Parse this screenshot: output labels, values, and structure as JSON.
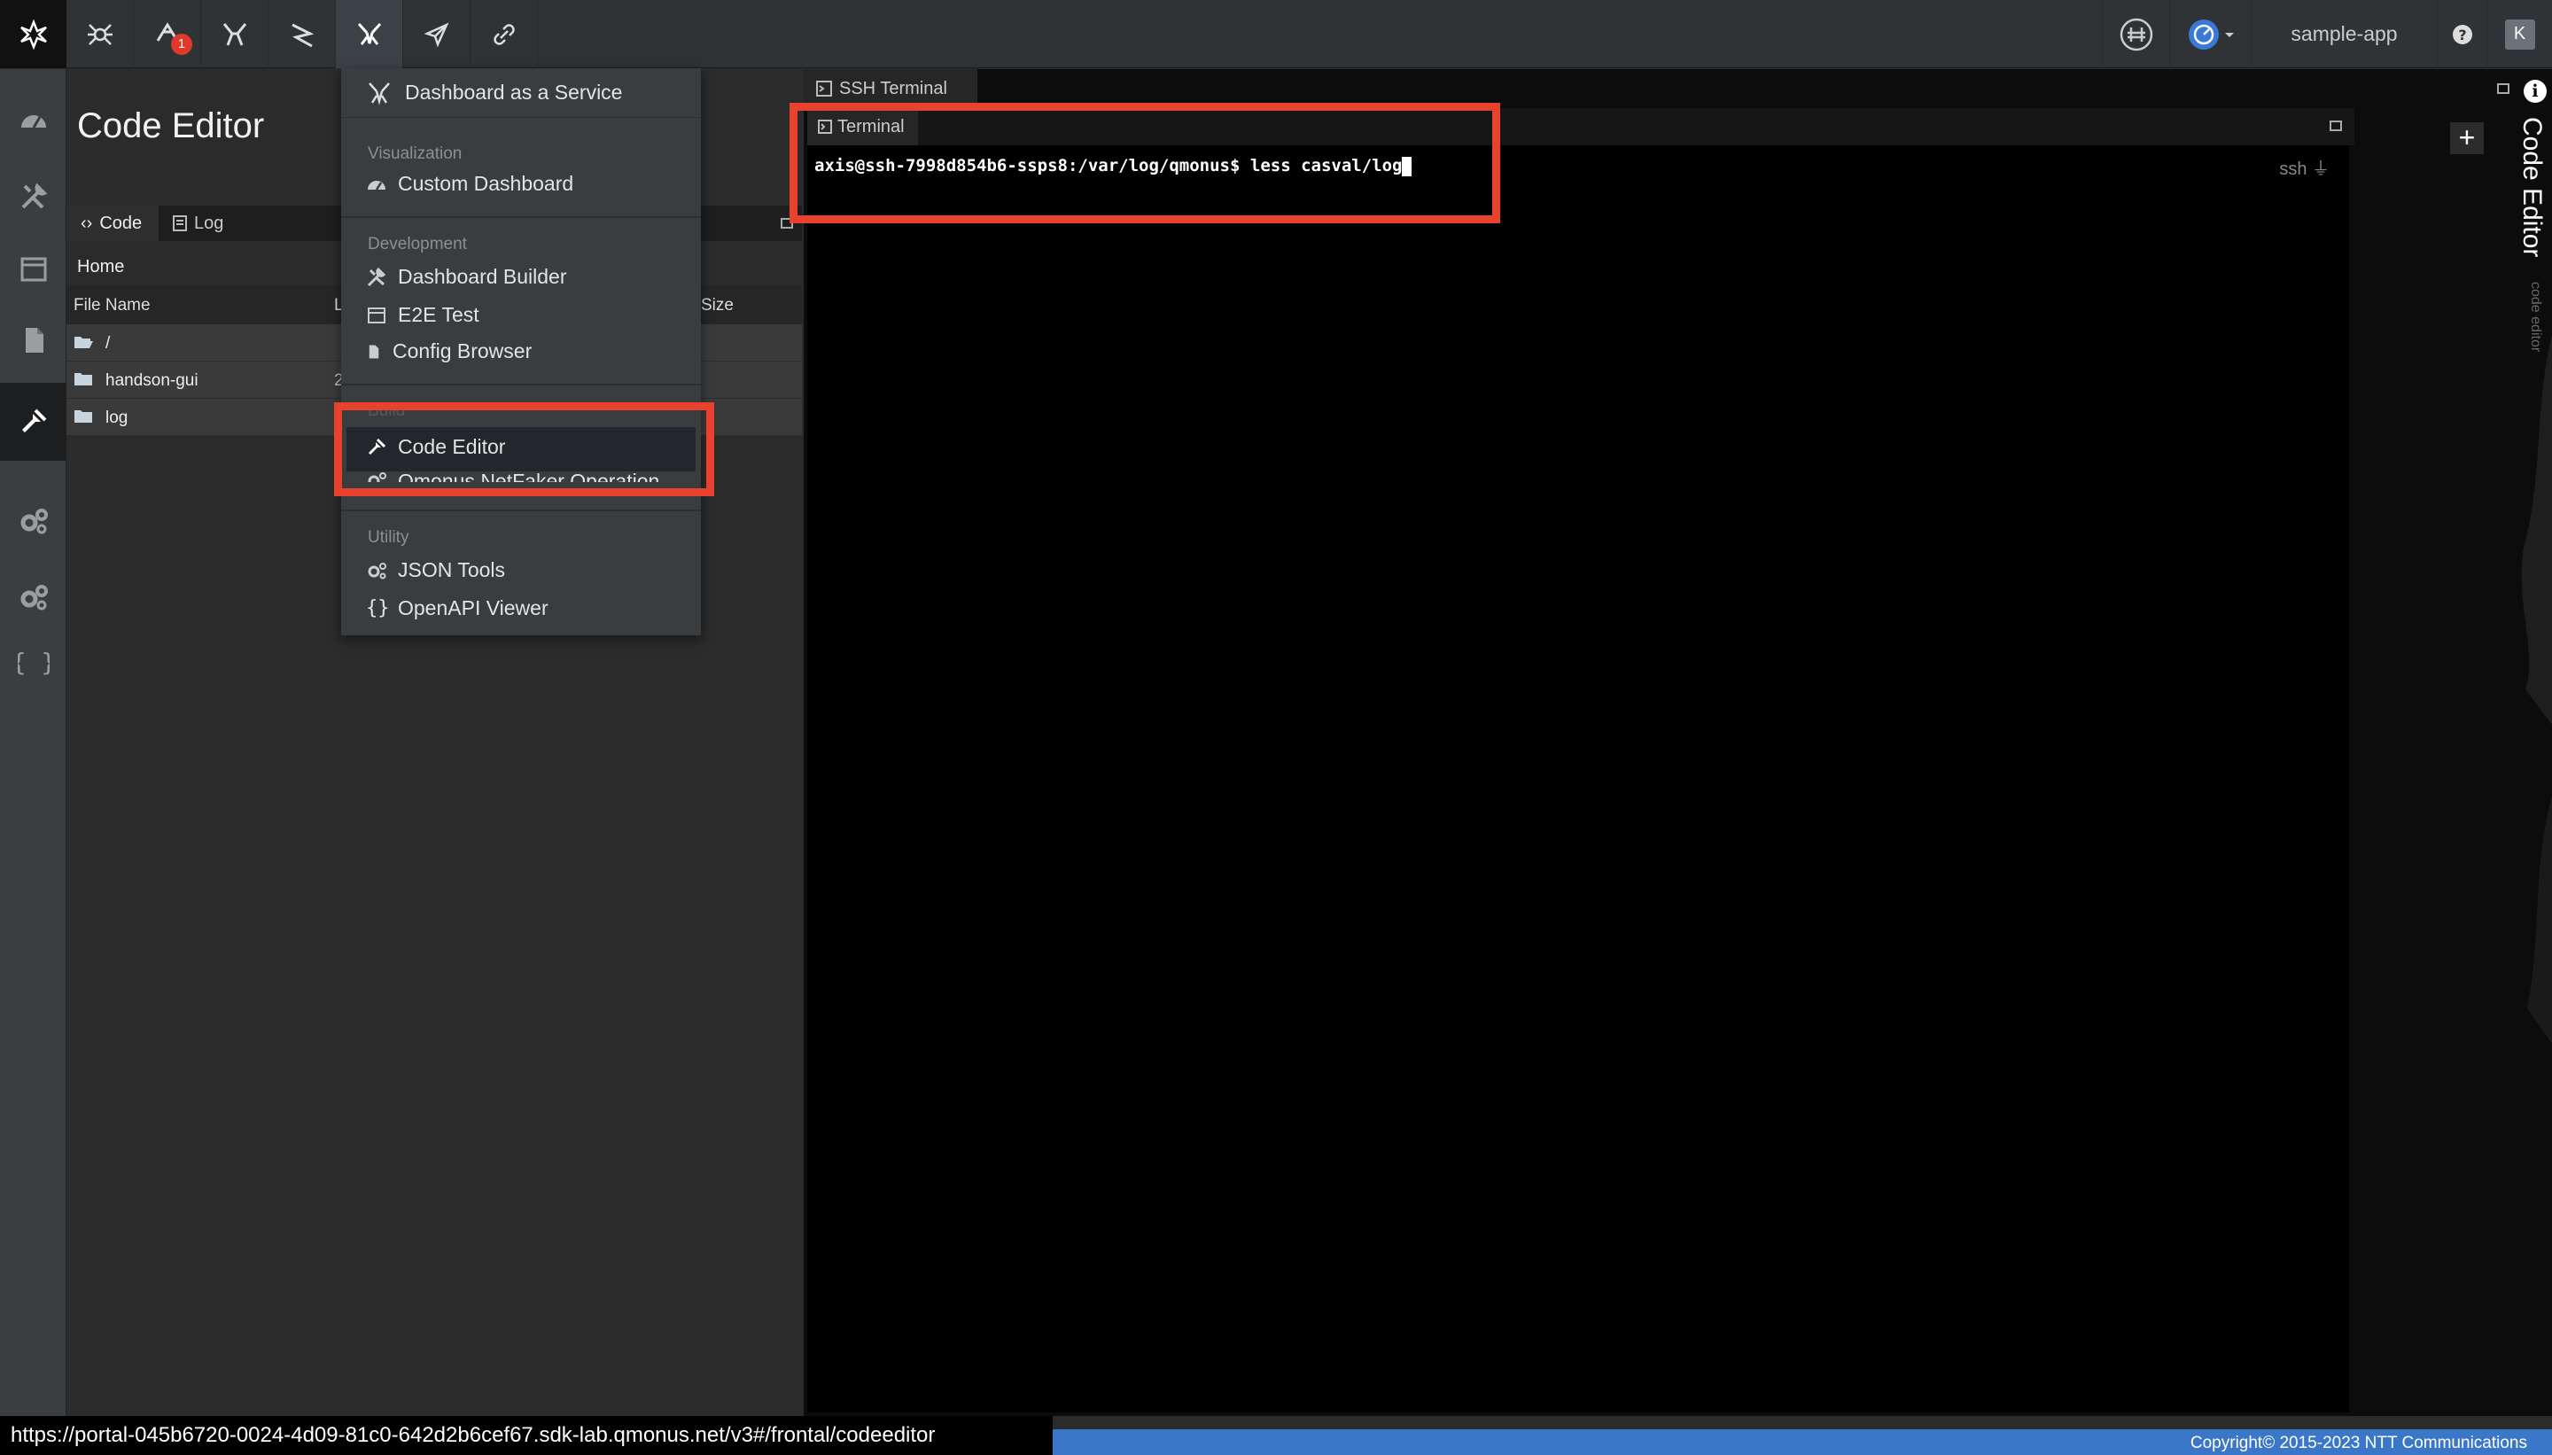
{
  "topbar": {
    "app_name": "sample-app",
    "avatar_letter": "K",
    "notification_count": "1",
    "icons": [
      "logo-icon",
      "spider-icon",
      "notification-icon",
      "claws-icon",
      "slash-icon",
      "tools-icon",
      "rocket-icon",
      "link-icon"
    ]
  },
  "sidebar": {
    "items": [
      "dashboard-icon",
      "tools-icon",
      "window-icon",
      "file-icon",
      "hammer-icon",
      "gears-icon",
      "gears-alt-icon",
      "braces-icon"
    ],
    "active_index": 4
  },
  "editor": {
    "title": "Code Editor",
    "tabs": [
      {
        "label": "Code",
        "active": true
      },
      {
        "label": "Log",
        "active": false
      }
    ],
    "breadcrumb": "Home",
    "columns": {
      "name": "File Name",
      "second": "L",
      "size": "Size"
    },
    "rows": [
      {
        "name": "/",
        "type": "folder-open",
        "extra": ""
      },
      {
        "name": "handson-gui",
        "type": "folder",
        "extra": "2"
      },
      {
        "name": "log",
        "type": "folder",
        "extra": ""
      }
    ]
  },
  "menu": {
    "header": "Dashboard as a Service",
    "sections": {
      "visualization": "Visualization",
      "development": "Development",
      "build": "Build",
      "utility": "Utility"
    },
    "items": {
      "custom_dashboard": "Custom Dashboard",
      "dashboard_builder": "Dashboard Builder",
      "e2e_test": "E2E Test",
      "config_browser": "Config Browser",
      "code_editor": "Code Editor",
      "netfaker": "Qmonus NetFaker Operation",
      "json_tools": "JSON Tools",
      "openapi_viewer": "OpenAPI Viewer"
    },
    "openapi_glyph": "{}",
    "highlighted": "Code Editor"
  },
  "terminal": {
    "outer_tab": "SSH Terminal",
    "inner_tab": "Terminal",
    "prompt": "axis@ssh-7998d854b6-ssps8:/var/log/qmonus$ less casval/log",
    "mode_label": "ssh",
    "plus": "+"
  },
  "right_strip": {
    "title": "Code Editor",
    "subtitle": "code editor",
    "info": "i"
  },
  "status": {
    "url": "https://portal-045b6720-0024-4d09-81c0-642d2b6cef67.sdk-lab.qmonus.net/v3#/frontal/codeeditor",
    "copyright": "Copyright© 2015-2023 NTT Communications"
  },
  "colors": {
    "highlight_box": "#e8412d",
    "footer": "#3a77c9",
    "topbar": "#2f3336"
  }
}
